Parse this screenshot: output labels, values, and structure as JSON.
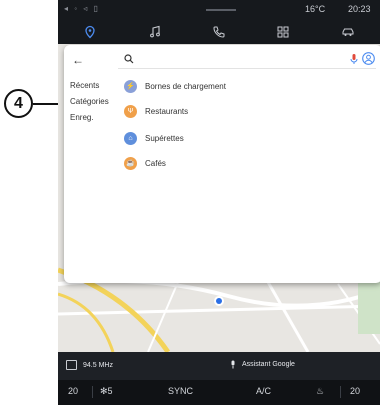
{
  "callout": {
    "number": "4"
  },
  "status": {
    "temperature": "16°C",
    "time": "20:23"
  },
  "nav": {
    "items": [
      {
        "icon": "map-pin-icon",
        "active": true
      },
      {
        "icon": "music-icon",
        "active": false
      },
      {
        "icon": "phone-icon",
        "active": false
      },
      {
        "icon": "apps-grid-icon",
        "active": false
      },
      {
        "icon": "car-icon",
        "active": false
      }
    ]
  },
  "panel": {
    "side_menu": [
      "Récents",
      "Catégories",
      "Enreg."
    ],
    "search_placeholder": "",
    "categories": [
      {
        "label": "Bornes de chargement",
        "color": "#8aa0d8",
        "icon": "charging-icon"
      },
      {
        "label": "Restaurants",
        "color": "#f0a04a",
        "icon": "restaurant-icon"
      },
      {
        "label": "Supérettes",
        "color": "#5f8fdc",
        "icon": "shopping-icon"
      },
      {
        "label": "Cafés",
        "color": "#f0a04a",
        "icon": "cafe-icon"
      }
    ]
  },
  "media": {
    "radio": "94.5 MHz",
    "assistant": "Assistant Google"
  },
  "climate": {
    "left_temp": "20",
    "fan": "5",
    "sync": "SYNC",
    "ac": "A/C",
    "right_temp": "20"
  }
}
